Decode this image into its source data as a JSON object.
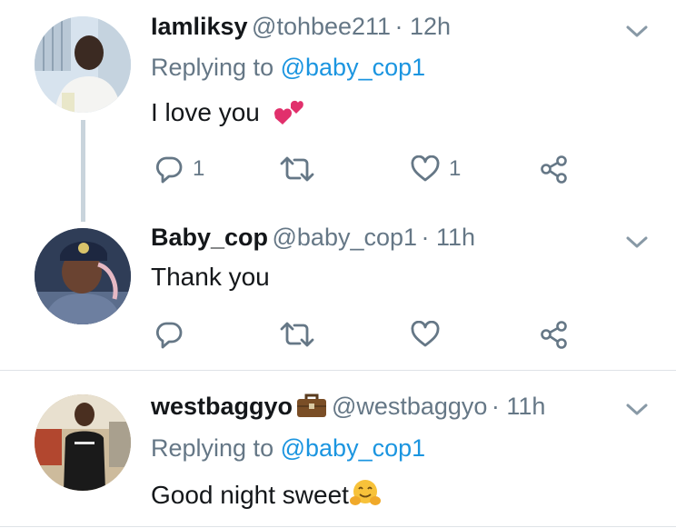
{
  "tweets": [
    {
      "name": "Iamliksy",
      "handle": "@tohbee211",
      "time": "· 12h",
      "reply_prefix": "Replying to",
      "reply_to": "@baby_cop1",
      "text": "I love you",
      "emoji": "two-hearts",
      "reply_count": "1",
      "retweet_count": "",
      "like_count": "1"
    },
    {
      "name": "Baby_cop",
      "handle": "@baby_cop1",
      "time": "· 11h",
      "text": "Thank you",
      "reply_count": "",
      "retweet_count": "",
      "like_count": ""
    },
    {
      "name": "westbaggyo",
      "name_emoji": "briefcase",
      "handle": "@westbaggyo",
      "time": "· 11h",
      "reply_prefix": "Replying to",
      "reply_to": "@baby_cop1",
      "text": "Good night sweet",
      "emoji": "hugging-face"
    }
  ],
  "colors": {
    "accent": "#1b95e0",
    "secondary": "#657786",
    "thread": "#c9d4dc"
  }
}
